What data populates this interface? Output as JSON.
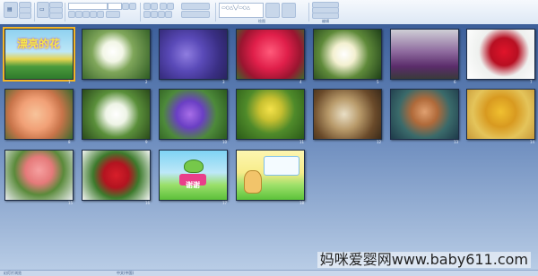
{
  "ribbon": {
    "groups": [
      {
        "id": "clipboard",
        "label": ""
      },
      {
        "id": "slides",
        "label": ""
      },
      {
        "id": "font",
        "label": ""
      },
      {
        "id": "paragraph",
        "label": ""
      },
      {
        "id": "drawing",
        "label": "绘图"
      },
      {
        "id": "editing",
        "label": "编辑"
      }
    ],
    "font_name": "",
    "font_size": ""
  },
  "slides": [
    {
      "number": "1",
      "theme": "title-flowers",
      "title_text": "漂亮的花"
    },
    {
      "number": "2",
      "theme": "white-lilies"
    },
    {
      "number": "3",
      "theme": "purple-hydrangea"
    },
    {
      "number": "4",
      "theme": "red-carnations"
    },
    {
      "number": "5",
      "theme": "white-chrysanthemums"
    },
    {
      "number": "6",
      "theme": "purple-callas"
    },
    {
      "number": "7",
      "theme": "red-rose"
    },
    {
      "number": "8",
      "theme": "peach-peonies"
    },
    {
      "number": "9",
      "theme": "white-petunias"
    },
    {
      "number": "10",
      "theme": "blue-morning-glories"
    },
    {
      "number": "11",
      "theme": "yellow-flowers"
    },
    {
      "number": "12",
      "theme": "dried-lily"
    },
    {
      "number": "13",
      "theme": "van-gogh-portrait"
    },
    {
      "number": "14",
      "theme": "sunflowers-painting"
    },
    {
      "number": "15",
      "theme": "pink-begonia-pot"
    },
    {
      "number": "16",
      "theme": "red-roses-bush"
    },
    {
      "number": "17",
      "theme": "cartoon-frog-thanks",
      "title_text": "谢谢"
    },
    {
      "number": "18",
      "theme": "cartoon-scene"
    }
  ],
  "statusbar": {
    "left": "幻灯片浏览",
    "theme": "",
    "language": "中文(中国)"
  },
  "watermark": "妈咪爱婴网www.baby611.com",
  "colors": {
    "canvas_top": "#3c5f9a",
    "canvas_bottom": "#b9cde6",
    "ribbon": "#dde8f5",
    "selection": "#f2b526"
  }
}
